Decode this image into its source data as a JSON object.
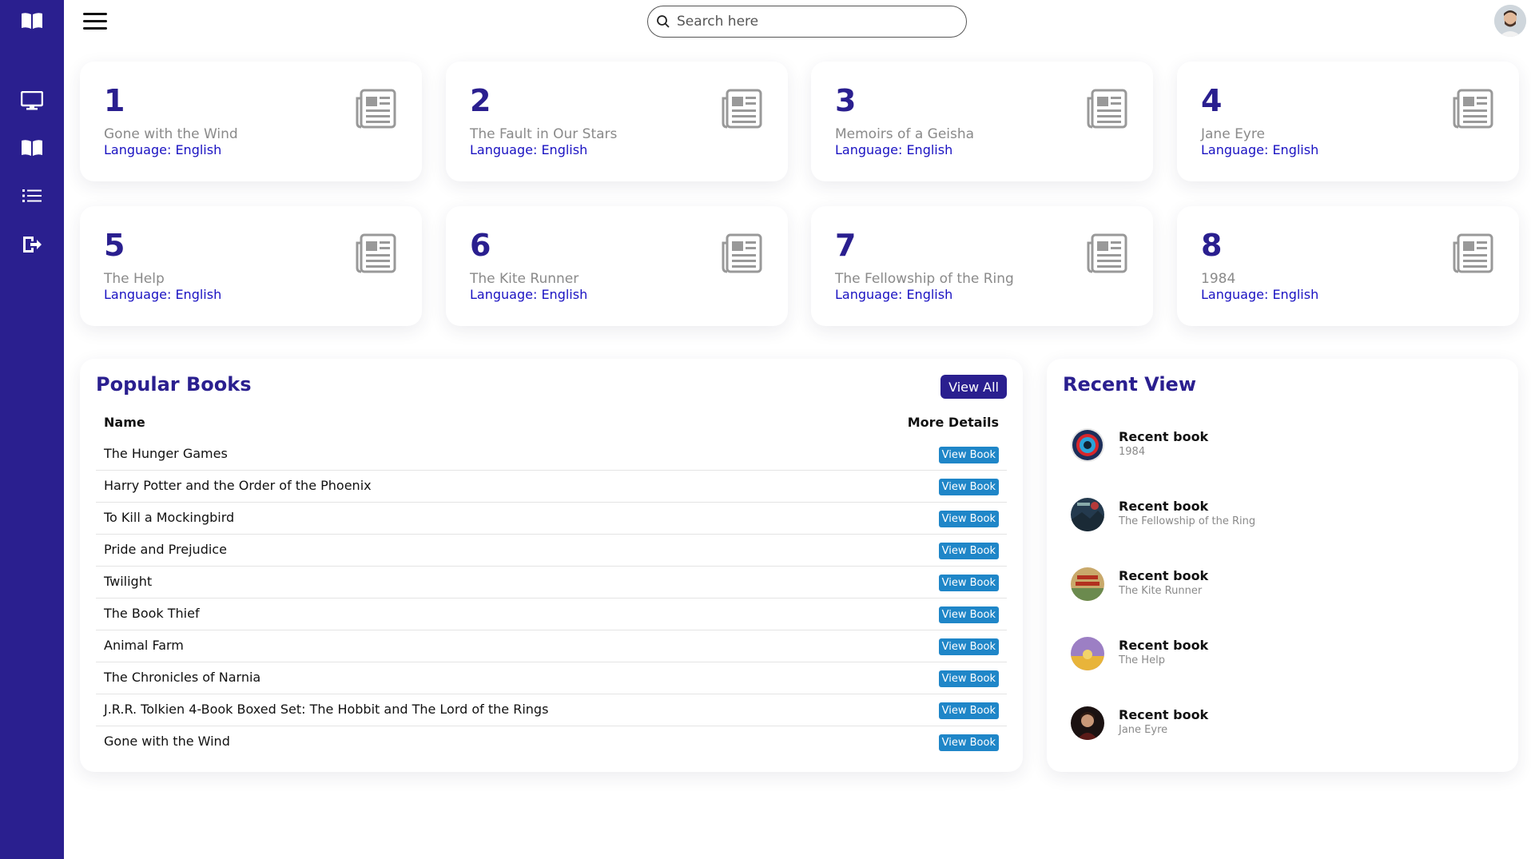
{
  "search": {
    "placeholder": "Search here"
  },
  "sidebar": {
    "items": [
      {
        "name": "logo",
        "icon": "book-open-icon"
      },
      {
        "name": "dashboard",
        "icon": "monitor-icon"
      },
      {
        "name": "books",
        "icon": "book-open-icon"
      },
      {
        "name": "list",
        "icon": "list-icon"
      },
      {
        "name": "logout",
        "icon": "sign-out-icon"
      }
    ]
  },
  "cards": [
    {
      "number": "1",
      "title": "Gone with the Wind",
      "language": "Language: English"
    },
    {
      "number": "2",
      "title": "The Fault in Our Stars",
      "language": "Language: English"
    },
    {
      "number": "3",
      "title": "Memoirs of a Geisha",
      "language": "Language: English"
    },
    {
      "number": "4",
      "title": "Jane Eyre",
      "language": "Language: English"
    },
    {
      "number": "5",
      "title": "The Help",
      "language": "Language: English"
    },
    {
      "number": "6",
      "title": "The Kite Runner",
      "language": "Language: English"
    },
    {
      "number": "7",
      "title": "The Fellowship of the Ring",
      "language": "Language: English"
    },
    {
      "number": "8",
      "title": "1984",
      "language": "Language: English"
    }
  ],
  "popular": {
    "title": "Popular Books",
    "view_all": "View All",
    "col_name": "Name",
    "col_details": "More Details",
    "button_label": "View Book",
    "books": [
      "The Hunger Games",
      "Harry Potter and the Order of the Phoenix",
      "To Kill a Mockingbird",
      "Pride and Prejudice",
      "Twilight",
      "The Book Thief",
      "Animal Farm",
      "The Chronicles of Narnia",
      "J.R.R. Tolkien 4-Book Boxed Set: The Hobbit and The Lord of the Rings",
      "Gone with the Wind"
    ]
  },
  "recent": {
    "title": "Recent View",
    "items": [
      {
        "label": "Recent book",
        "book": "1984"
      },
      {
        "label": "Recent book",
        "book": "The Fellowship of the Ring"
      },
      {
        "label": "Recent book",
        "book": "The Kite Runner"
      },
      {
        "label": "Recent book",
        "book": "The Help"
      },
      {
        "label": "Recent book",
        "book": "Jane Eyre"
      }
    ]
  },
  "colors": {
    "primary": "#2a1f8f",
    "language_text": "#1a12c2",
    "view_book_button": "#1f86c8",
    "card_title": "#8a8a8a"
  }
}
